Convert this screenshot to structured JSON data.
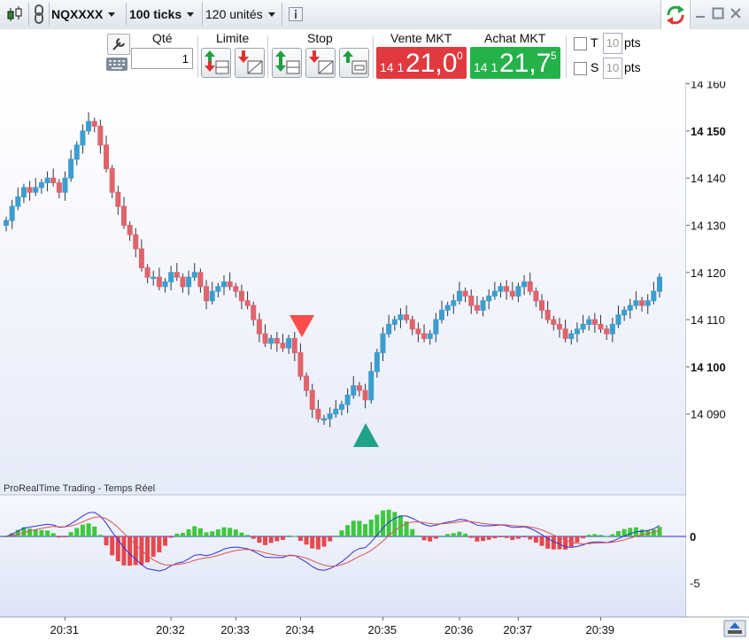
{
  "toolbar": {
    "symbol": "NQXXXX",
    "period": "100 ticks",
    "units": "120 unités",
    "icons": [
      "candlestick-icon",
      "link-icon",
      "info-icon",
      "refresh-icon",
      "minimize-icon",
      "maximize-icon",
      "close-icon"
    ]
  },
  "order_panel": {
    "qty_label": "Qté",
    "qty_value": "1",
    "limit_label": "Limite",
    "stop_label": "Stop",
    "sell_label": "Vente MKT",
    "buy_label": "Achat MKT",
    "sell_price_small": "14 1",
    "sell_price_big": "21,0",
    "sell_price_sup": "0",
    "buy_price_small": "14 1",
    "buy_price_big": "21,7",
    "buy_price_sup": "5",
    "t_label": "T",
    "s_label": "S",
    "t_value": "10",
    "s_value": "10",
    "pts_label": "pts",
    "colors": {
      "sell": "#e0393e",
      "buy": "#26b24b"
    }
  },
  "chart_data": [
    {
      "type": "candlestick",
      "title": "",
      "ylim": [
        14081,
        14163
      ],
      "y_ticks": [
        "14 160",
        "14 150",
        "14 140",
        "14 130",
        "14 120",
        "14 110",
        "14 100",
        "14 090"
      ],
      "y_ticks_bold": [
        "14 150",
        "14 100"
      ],
      "x_ticks": [
        "20:31",
        "20:32",
        "20:33",
        "20:34",
        "20:35",
        "20:36",
        "20:37",
        "20:39"
      ],
      "colors": {
        "up": "#3a9ed0",
        "down": "#e0646b"
      },
      "markers": [
        {
          "type": "sell-arrow",
          "color": "#ff4b4b",
          "near_price": 14110
        },
        {
          "type": "buy-arrow",
          "color": "#21a387",
          "near_price": 14089
        }
      ],
      "closes": [
        14131,
        14134,
        14136,
        14138,
        14137,
        14138,
        14139,
        14140,
        14139,
        14137,
        14140,
        14144,
        14147,
        14150,
        14152,
        14151,
        14147,
        14142,
        14137,
        14134,
        14130,
        14128,
        14125,
        14121,
        14119,
        14119,
        14117,
        14118,
        14120,
        14119,
        14117,
        14119,
        14120,
        14117,
        14114,
        14116,
        14117,
        14118,
        14117,
        14116,
        14114,
        14113,
        14110,
        14107,
        14105,
        14106,
        14105,
        14104,
        14106,
        14103,
        14098,
        14095,
        14091,
        14089,
        14089,
        14090,
        14091,
        14092,
        14094,
        14096,
        14095,
        14093,
        14099,
        14103,
        14107,
        14109,
        14110,
        14111,
        14110,
        14108,
        14107,
        14106,
        14107,
        14110,
        14112,
        14113,
        14114,
        14116,
        14115,
        14113,
        14112,
        14114,
        14115,
        14116,
        14117,
        14116,
        14115,
        14117,
        14118,
        14116,
        14114,
        14112,
        14110,
        14109,
        14108,
        14106,
        14107,
        14108,
        14109,
        14110,
        14109,
        14108,
        14107,
        14109,
        14111,
        14112,
        14113,
        14114,
        14113,
        14114,
        14116,
        14119
      ]
    },
    {
      "type": "histogram+lines",
      "title": "ProRealTime Trading - Temps Réel",
      "y_ticks": [
        "0",
        "-5"
      ],
      "ylim": [
        -8.4,
        4.2
      ]
    }
  ]
}
